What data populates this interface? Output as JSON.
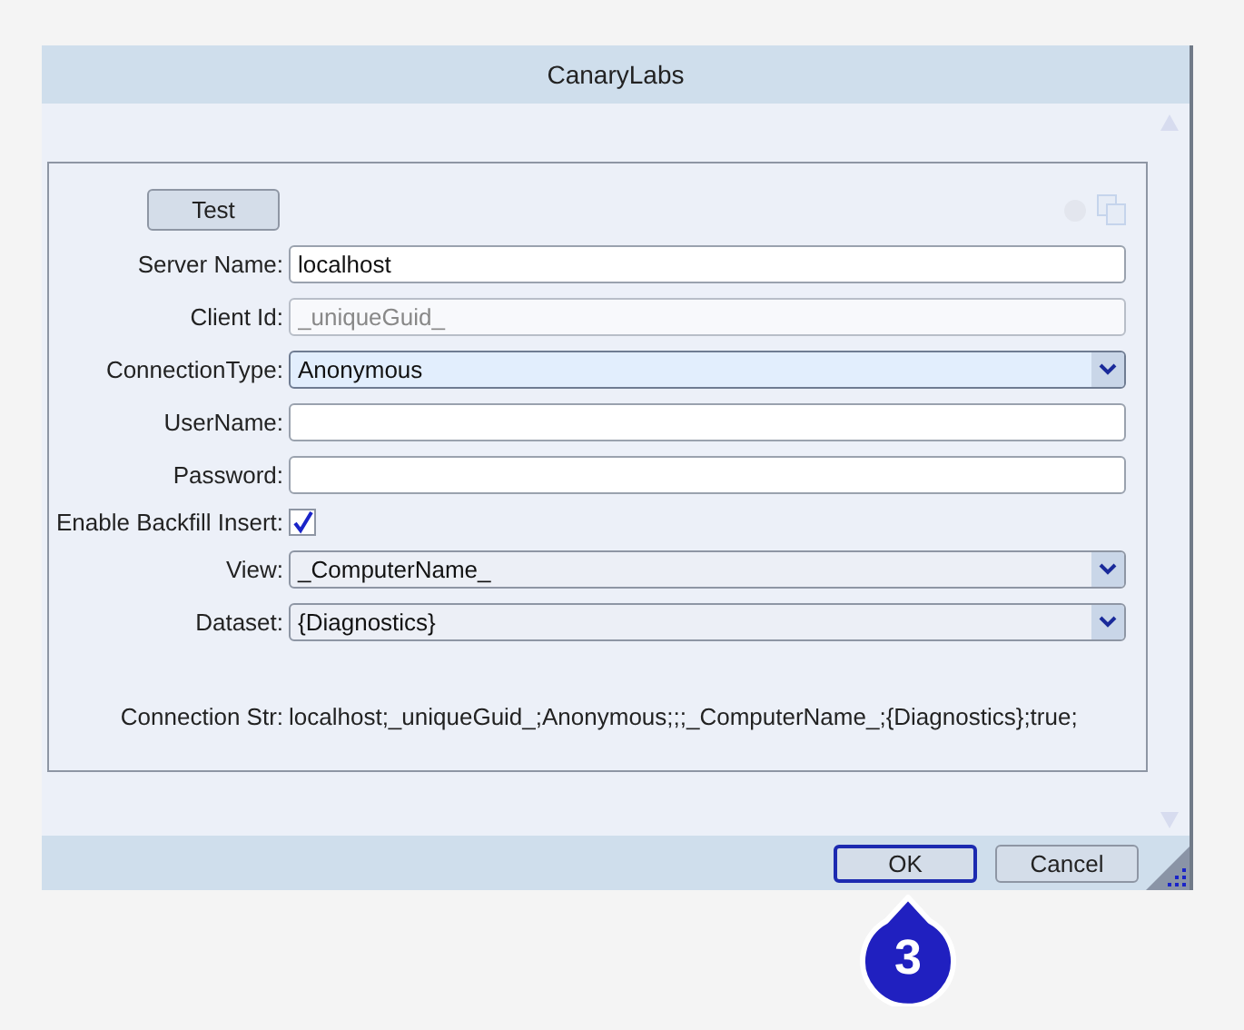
{
  "window": {
    "title": "CanaryLabs"
  },
  "test_button": {
    "label": "Test"
  },
  "fields": [
    {
      "kind": "text",
      "label": "Server Name:",
      "value": "localhost",
      "disabled": false
    },
    {
      "kind": "text",
      "label": "Client Id:",
      "value": "_uniqueGuid_",
      "disabled": true
    },
    {
      "kind": "select",
      "label": "ConnectionType:",
      "value": "Anonymous",
      "highlighted": true
    },
    {
      "kind": "text",
      "label": "UserName:",
      "disabled": false
    },
    {
      "kind": "text",
      "label": "Password:",
      "disabled": false
    },
    {
      "kind": "checkbox",
      "label": "Enable Backfill Insert:",
      "checked": true
    },
    {
      "kind": "select",
      "label": "View:",
      "value": "_ComputerName_",
      "highlighted": false
    },
    {
      "kind": "select",
      "label": "Dataset:",
      "value": "{Diagnostics}",
      "highlighted": false
    }
  ],
  "connection_string": {
    "label": "Connection Str:",
    "value": "localhost;_uniqueGuid_;Anonymous;;;_ComputerName_;{Diagnostics};true;"
  },
  "buttons": [
    {
      "label": "OK",
      "default": true
    },
    {
      "label": "Cancel",
      "default": false
    }
  ],
  "callout": {
    "number": "3"
  }
}
